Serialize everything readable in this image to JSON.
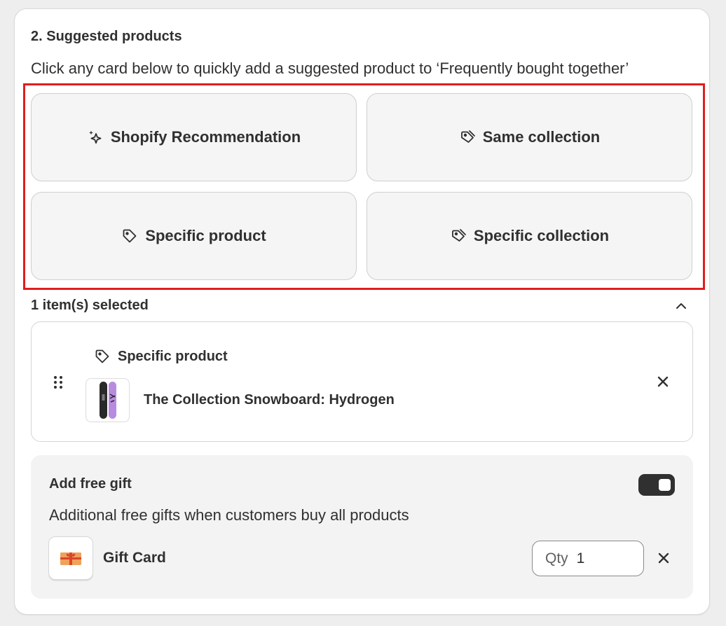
{
  "section": {
    "title": "2. Suggested products",
    "description": "Click any card below to quickly add a suggested product to ‘Frequently bought together’"
  },
  "options": [
    {
      "label": "Shopify Recommendation",
      "icon": "sparkle-icon"
    },
    {
      "label": "Same collection",
      "icon": "tags-icon"
    },
    {
      "label": "Specific product",
      "icon": "tag-icon"
    },
    {
      "label": "Specific collection",
      "icon": "tags-icon"
    }
  ],
  "selected": {
    "count_label": "1 item(s) selected",
    "item": {
      "type_label": "Specific product",
      "product_name": "The Collection Snowboard: Hydrogen"
    }
  },
  "gift": {
    "title": "Add free gift",
    "enabled": true,
    "description": "Additional free gifts when customers buy all products",
    "name": "Gift Card",
    "qty_label": "Qty",
    "qty_value": "1"
  },
  "colors": {
    "highlight": "#e11d1d",
    "toggle_on": "#303030",
    "text": "#303030"
  }
}
